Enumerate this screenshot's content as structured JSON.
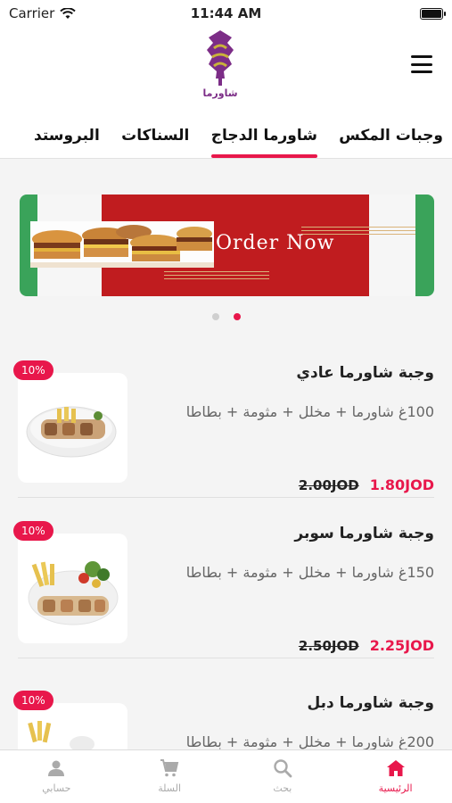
{
  "status": {
    "carrier": "Carrier",
    "time": "11:44 AM"
  },
  "header": {
    "logo_text": "شاورما"
  },
  "tabs": [
    {
      "label": "وجبات المكس"
    },
    {
      "label": "شاورما الدجاج",
      "active": true
    },
    {
      "label": "السناكات"
    },
    {
      "label": "البروستد"
    }
  ],
  "banner": {
    "text": "Order Now",
    "colors": {
      "green": "#3aa35a",
      "red": "#c01c1f"
    }
  },
  "carousel": {
    "count": 2,
    "active_index": 1
  },
  "meals": [
    {
      "title": "وجبة شاورما عادي",
      "description": "100غ شاورما + مخلل + مثومة + بطاطا",
      "old_price": "2.00JOD",
      "new_price": "1.80JOD",
      "discount": "10%"
    },
    {
      "title": "وجبة شاورما سوبر",
      "description": "150غ شاورما + مخلل + مثومة + بطاطا",
      "old_price": "2.50JOD",
      "new_price": "2.25JOD",
      "discount": "10%"
    },
    {
      "title": "وجبة شاورما دبل",
      "description": "200غ شاورما + مخلل + مثومة + بطاطا",
      "discount": "10%"
    }
  ],
  "bottom_nav": [
    {
      "label": "حسابي",
      "icon": "user-icon"
    },
    {
      "label": "السلة",
      "icon": "cart-icon"
    },
    {
      "label": "بحث",
      "icon": "search-icon"
    },
    {
      "label": "الرئيسية",
      "icon": "home-icon",
      "active": true
    }
  ],
  "theme": {
    "accent": "#e8174b"
  }
}
